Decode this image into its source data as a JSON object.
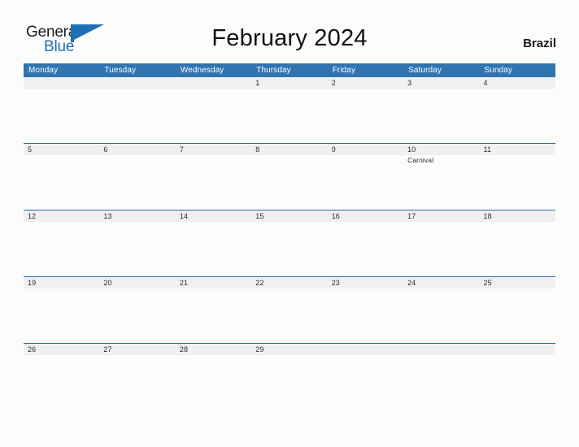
{
  "branding": {
    "logo_text_primary": "General",
    "logo_text_secondary": "Blue",
    "accent_color": "#1f6fb2"
  },
  "header": {
    "title": "February 2024",
    "country": "Brazil"
  },
  "calendar": {
    "header_bg_color": "#3074b0",
    "band_bg_color": "#f0f0f0",
    "row_line_color": "#2a6ca8",
    "weekday_headers": [
      "Monday",
      "Tuesday",
      "Wednesday",
      "Thursday",
      "Friday",
      "Saturday",
      "Sunday"
    ],
    "weeks": [
      [
        {
          "day": ""
        },
        {
          "day": ""
        },
        {
          "day": ""
        },
        {
          "day": "1"
        },
        {
          "day": "2"
        },
        {
          "day": "3"
        },
        {
          "day": "4"
        }
      ],
      [
        {
          "day": "5"
        },
        {
          "day": "6"
        },
        {
          "day": "7"
        },
        {
          "day": "8"
        },
        {
          "day": "9"
        },
        {
          "day": "10",
          "event": "Carnival"
        },
        {
          "day": "11"
        }
      ],
      [
        {
          "day": "12"
        },
        {
          "day": "13"
        },
        {
          "day": "14"
        },
        {
          "day": "15"
        },
        {
          "day": "16"
        },
        {
          "day": "17"
        },
        {
          "day": "18"
        }
      ],
      [
        {
          "day": "19"
        },
        {
          "day": "20"
        },
        {
          "day": "21"
        },
        {
          "day": "22"
        },
        {
          "day": "23"
        },
        {
          "day": "24"
        },
        {
          "day": "25"
        }
      ],
      [
        {
          "day": "26"
        },
        {
          "day": "27"
        },
        {
          "day": "28"
        },
        {
          "day": "29"
        },
        {
          "day": ""
        },
        {
          "day": ""
        },
        {
          "day": ""
        }
      ]
    ]
  }
}
